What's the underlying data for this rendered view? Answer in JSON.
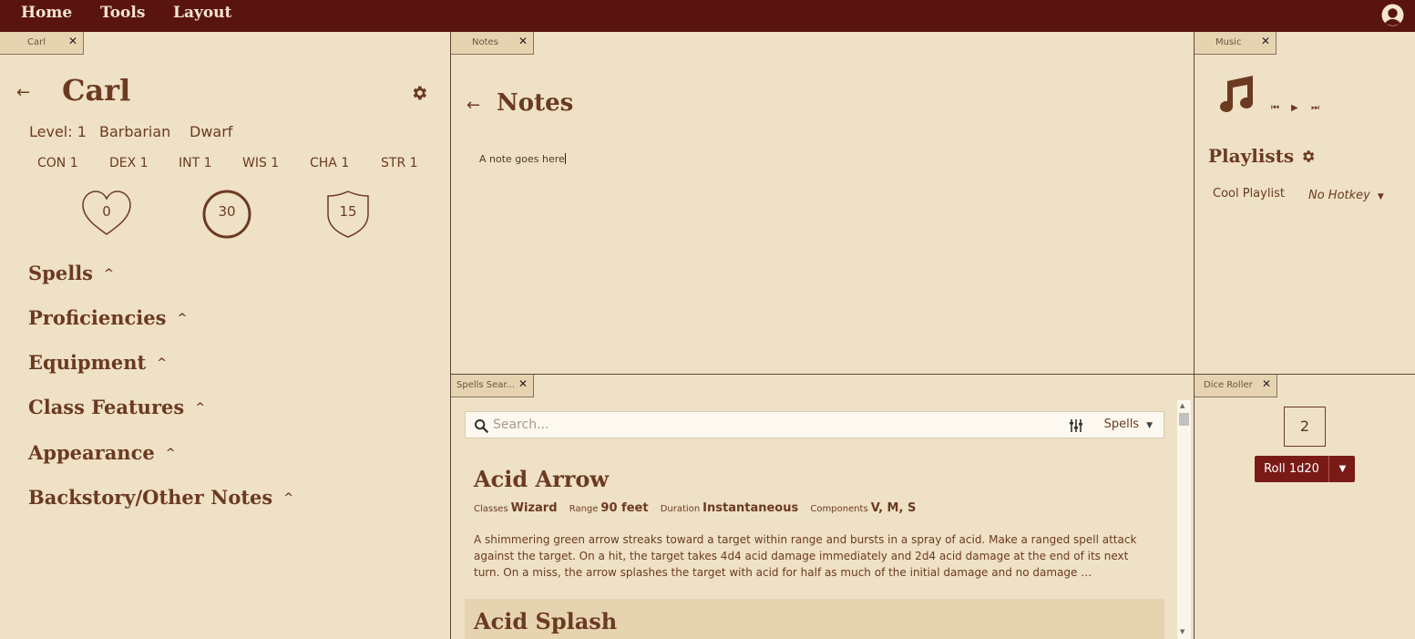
{
  "menu": {
    "items": [
      "Home",
      "Tools",
      "Layout"
    ]
  },
  "carl": {
    "tab": "Carl",
    "name": "Carl",
    "level": "Level: 1",
    "class": "Barbarian",
    "race": "Dwarf",
    "stats": [
      "CON 1",
      "DEX 1",
      "INT 1",
      "WIS 1",
      "CHA 1",
      "STR 1"
    ],
    "hp": "0",
    "level_circle": "30",
    "ac": "15",
    "sections": [
      "Spells",
      "Proficiencies",
      "Equipment",
      "Class Features",
      "Appearance",
      "Backstory/Other Notes"
    ]
  },
  "notes": {
    "tab": "Notes",
    "title": "Notes",
    "text": "A note goes here"
  },
  "music": {
    "tab": "Music",
    "playlists_title": "Playlists",
    "playlist_name": "Cool Playlist",
    "hotkey": "No Hotkey"
  },
  "spells": {
    "tab": "Spells Sear...",
    "search_placeholder": "Search...",
    "filter": "Spells",
    "list": [
      {
        "name": "Acid Arrow",
        "classes_label": "Classes",
        "classes": "Wizard",
        "range_label": "Range",
        "range": "90 feet",
        "duration_label": "Duration",
        "duration": "Instantaneous",
        "components_label": "Components",
        "components": "V, M, S",
        "description": "A shimmering green arrow streaks toward a target within range and bursts in a spray of acid. Make a ranged spell attack against the target. On a hit, the target takes 4d4 acid damage immediately and 2d4 acid damage at the end of its next turn. On a miss, the arrow splashes the target with acid for half as much of the initial damage and no damage …"
      },
      {
        "name": "Acid Splash"
      }
    ]
  },
  "dice": {
    "tab": "Dice Roller",
    "result": "2",
    "roll_label": "Roll 1d20"
  }
}
